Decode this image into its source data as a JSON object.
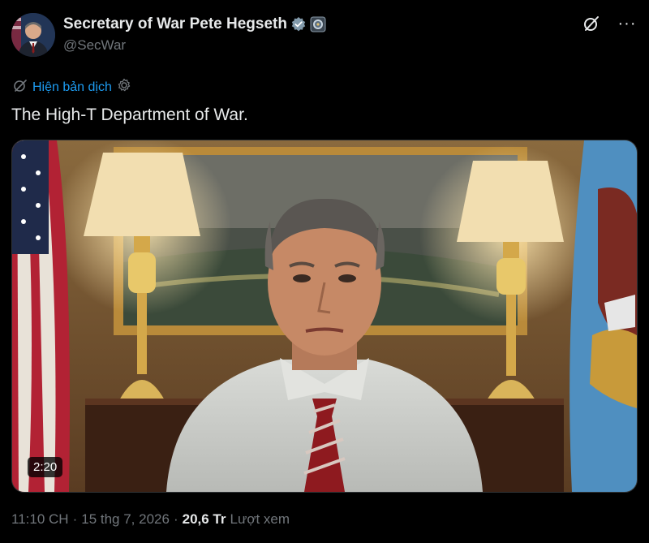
{
  "author": {
    "display_name": "Secretary of War Pete Hegseth",
    "handle": "@SecWar",
    "avatar_icon": "avatar-photo",
    "verified_icon": "verified-badge-icon",
    "affiliation_icon": "government-affiliation-icon"
  },
  "header_actions": {
    "grok_icon": "grok-icon",
    "more_label": "···"
  },
  "translate": {
    "label": "Hiện bản dịch",
    "settings_icon": "gear-icon"
  },
  "post": {
    "text": "The High-T Department of War."
  },
  "media": {
    "type": "video",
    "duration": "2:20"
  },
  "meta": {
    "time": "11:10 CH",
    "separator": "·",
    "date": "15 thg 7, 2026",
    "views_count": "20,6 Tr",
    "views_label": "Lượt xem"
  },
  "colors": {
    "background": "#000000",
    "text_primary": "#e7e9ea",
    "text_secondary": "#71767b",
    "accent": "#1d9bf0"
  }
}
